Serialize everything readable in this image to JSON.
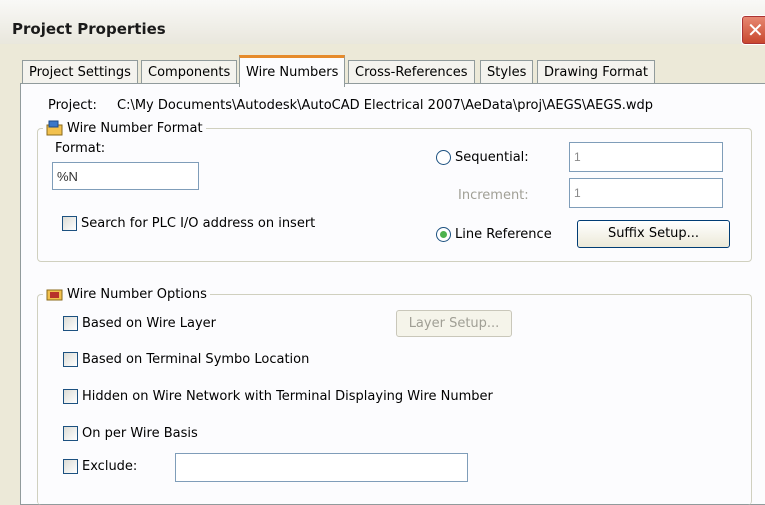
{
  "window": {
    "title": "Project Properties",
    "close_symbol": "✕"
  },
  "tabs": [
    {
      "label": "Project Settings"
    },
    {
      "label": "Components"
    },
    {
      "label": "Wire Numbers"
    },
    {
      "label": "Cross-References"
    },
    {
      "label": "Styles"
    },
    {
      "label": "Drawing Format"
    }
  ],
  "active_tab": "Wire Numbers",
  "project": {
    "label": "Project:",
    "path": "C:\\My Documents\\Autodesk\\AutoCAD Electrical 2007\\AeData\\proj\\AEGS\\AEGS.wdp"
  },
  "format_group": {
    "title": "Wire Number Format",
    "icon": "wire-format-icon",
    "format_label": "Format:",
    "format_value": "%N",
    "sequential_label": "Sequential:",
    "sequential_value": "1",
    "sequential_selected": false,
    "increment_label": "Increment:",
    "increment_value": "1",
    "line_reference_label": "Line Reference",
    "line_reference_selected": true,
    "suffix_button": "Suffix Setup...",
    "plc_label": "Search for PLC I/O address on insert",
    "plc_checked": false
  },
  "options_group": {
    "title": "Wire Number Options",
    "icon": "wire-options-icon",
    "based_on_layer": "Based on Wire Layer",
    "layer_setup_button": "Layer Setup...",
    "terminal_symbol": "Based on Terminal Symbo Location",
    "hidden_network": "Hidden on Wire Network with Terminal Displaying Wire Number",
    "per_wire": "On per Wire Basis",
    "exclude": "Exclude:",
    "exclude_value": ""
  },
  "colors": {
    "tab_accent": "#e68b2c",
    "radio_dot": "#4db24d",
    "close": "#c7452c"
  }
}
